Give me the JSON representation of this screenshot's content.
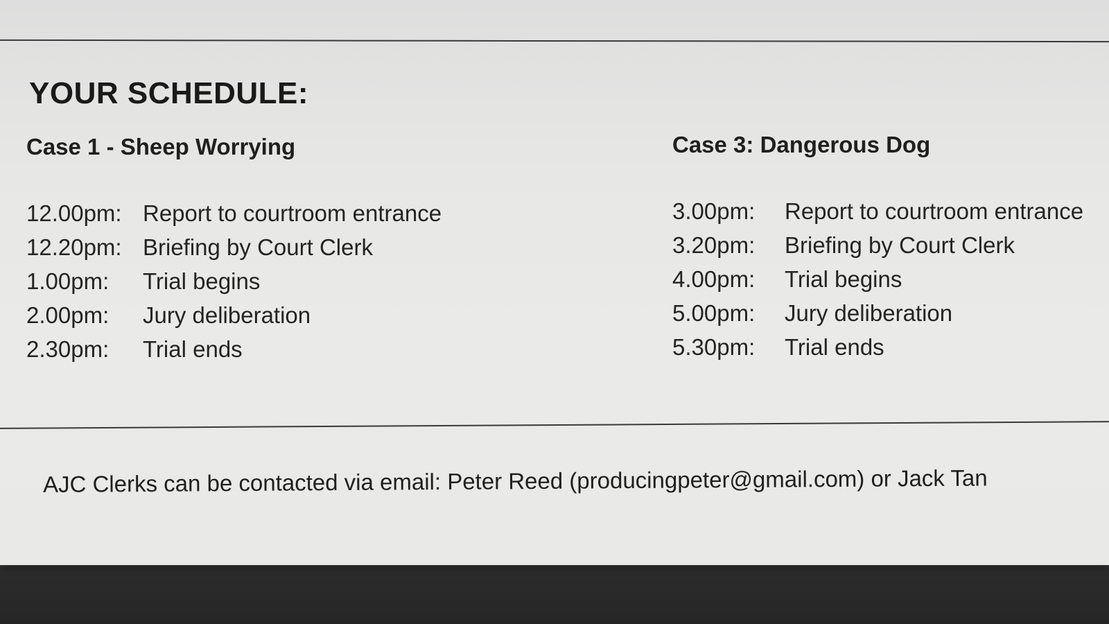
{
  "schedule": {
    "heading": "YOUR SCHEDULE:",
    "cases": [
      {
        "title": "Case 1 - Sheep Worrying",
        "entries": [
          {
            "time": "12.00pm:",
            "event": "Report to courtroom entrance"
          },
          {
            "time": "12.20pm:",
            "event": "Briefing by Court Clerk"
          },
          {
            "time": "1.00pm:",
            "event": "Trial begins"
          },
          {
            "time": "2.00pm:",
            "event": "Jury deliberation"
          },
          {
            "time": "2.30pm:",
            "event": "Trial ends"
          }
        ]
      },
      {
        "title": "Case 3: Dangerous Dog",
        "entries": [
          {
            "time": "3.00pm:",
            "event": "Report to courtroom entrance"
          },
          {
            "time": "3.20pm:",
            "event": "Briefing by Court Clerk"
          },
          {
            "time": "4.00pm:",
            "event": "Trial begins"
          },
          {
            "time": "5.00pm:",
            "event": "Jury deliberation"
          },
          {
            "time": "5.30pm:",
            "event": "Trial ends"
          }
        ]
      }
    ]
  },
  "footer": {
    "contact_text": "AJC Clerks can be contacted via email: Peter Reed (producingpeter@gmail.com) or Jack Tan"
  }
}
